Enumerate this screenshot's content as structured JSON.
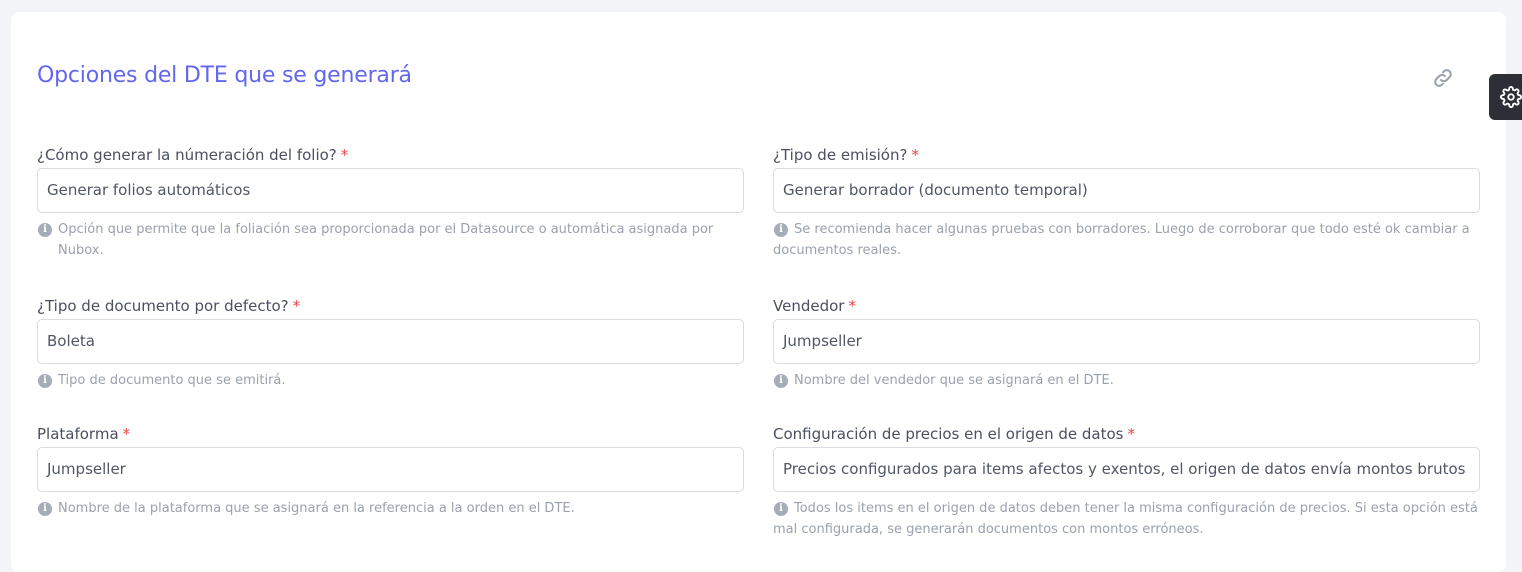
{
  "section": {
    "title": "Opciones del DTE que se generará"
  },
  "fields": {
    "folio": {
      "label": "¿Cómo generar la númeración del folio?",
      "value": "Generar folios automáticos",
      "help": "Opción que permite que la foliación sea proporcionada por el Datasource o automática asignada por Nubox."
    },
    "emision": {
      "label": "¿Tipo de emisión?",
      "value": "Generar borrador (documento temporal)",
      "help": "Se recomienda hacer algunas pruebas con borradores. Luego de corroborar que todo esté ok cambiar a documentos reales."
    },
    "tipo_documento": {
      "label": "¿Tipo de documento por defecto?",
      "value": "Boleta",
      "help": "Tipo de documento que se emitirá."
    },
    "vendedor": {
      "label": "Vendedor",
      "value": "Jumpseller",
      "help": "Nombre del vendedor que se asignará en el DTE."
    },
    "plataforma": {
      "label": "Plataforma",
      "value": "Jumpseller",
      "help": "Nombre de la plataforma que se asignará en la referencia a la orden en el DTE."
    },
    "precios": {
      "label": "Configuración de precios en el origen de datos",
      "value": "Precios configurados para items afectos y exentos, el origen de datos envía montos brutos",
      "help": "Todos los items en el origen de datos deben tener la misma configuración de precios. Si esta opción está mal configurada, se generarán documentos con montos erróneos."
    }
  },
  "required_marker": "*",
  "info_glyph": "i",
  "colors": {
    "title": "#6366f1",
    "required": "#ef4444",
    "gear_tab_bg": "#2c2f36"
  },
  "icons": {
    "link": "link-icon",
    "gear": "gear-icon",
    "info": "info-icon"
  }
}
